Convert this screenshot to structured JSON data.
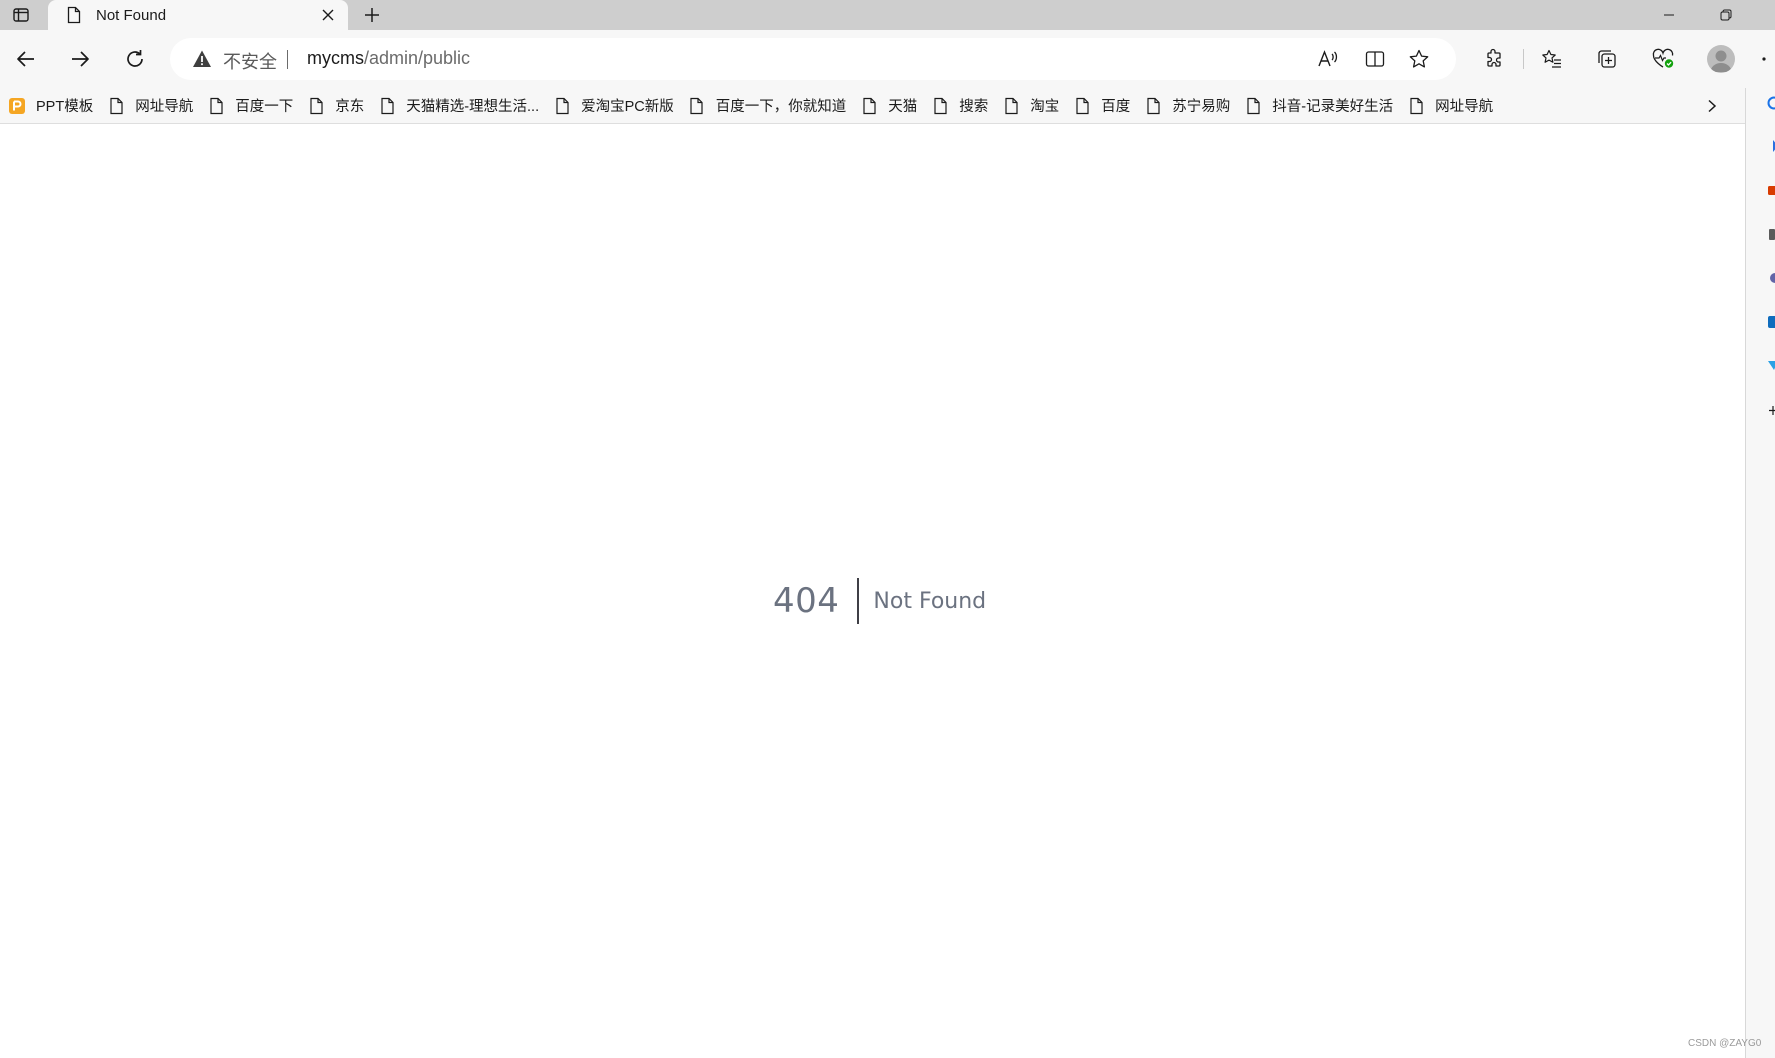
{
  "tab": {
    "title": "Not Found"
  },
  "toolbar": {
    "security_label": "不安全",
    "url_host": "mycms",
    "url_path": "/admin/public"
  },
  "bookmarks": [
    {
      "label": "PPT模板",
      "icon": "ppt-logo-icon"
    },
    {
      "label": "网址导航",
      "icon": "page-icon"
    },
    {
      "label": "百度一下",
      "icon": "page-icon"
    },
    {
      "label": "京东",
      "icon": "page-icon"
    },
    {
      "label": "天猫精选-理想生活...",
      "icon": "page-icon"
    },
    {
      "label": "爱淘宝PC新版",
      "icon": "page-icon"
    },
    {
      "label": "百度一下，你就知道",
      "icon": "page-icon"
    },
    {
      "label": "天猫",
      "icon": "page-icon"
    },
    {
      "label": "搜索",
      "icon": "page-icon"
    },
    {
      "label": "淘宝",
      "icon": "page-icon"
    },
    {
      "label": "百度",
      "icon": "page-icon"
    },
    {
      "label": "苏宁易购",
      "icon": "page-icon"
    },
    {
      "label": "抖音-记录美好生活",
      "icon": "page-icon"
    },
    {
      "label": "网址导航",
      "icon": "page-icon"
    }
  ],
  "page": {
    "error_code": "404",
    "error_message": "Not Found"
  },
  "watermark": "CSDN @ZAYG0",
  "colors": {
    "tab_strip": "#cecece",
    "toolbar": "#f7f7f7",
    "ppt_brand": "#f5a623",
    "error_text": "#6b7280"
  }
}
